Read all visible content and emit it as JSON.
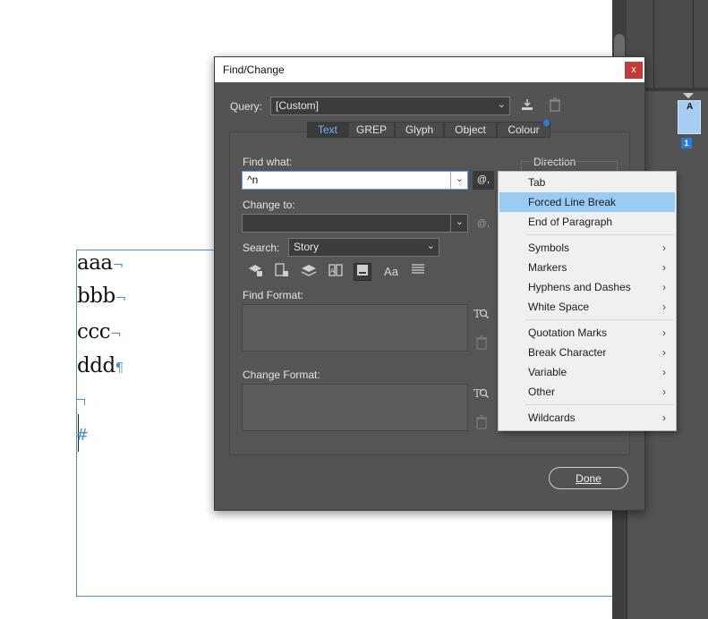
{
  "document": {
    "lines": [
      {
        "text": "aaa",
        "mark": "¬"
      },
      {
        "text": "bbb",
        "mark": "¬"
      },
      {
        "text": "ccc",
        "mark": "¬"
      },
      {
        "text": "ddd",
        "mark": "¶"
      }
    ],
    "end_mark": "#"
  },
  "pages_panel": {
    "master_label": "A",
    "page_number": "1"
  },
  "dialog": {
    "title": "Find/Change",
    "close_label": "x",
    "query_label": "Query:",
    "query_value": "[Custom]",
    "tabs": [
      {
        "label": "Text",
        "active": true
      },
      {
        "label": "GREP",
        "active": false
      },
      {
        "label": "Glyph",
        "active": false
      },
      {
        "label": "Object",
        "active": false
      },
      {
        "label": "Colour",
        "active": false
      }
    ],
    "find_what_label": "Find what:",
    "find_what_value": "^n",
    "direction_label": "Direction",
    "change_to_label": "Change to:",
    "change_to_value": "",
    "search_label": "Search:",
    "search_value": "Story",
    "find_format_label": "Find Format:",
    "change_format_label": "Change Format:",
    "done_label": "Done",
    "special_char_icon": "@,"
  },
  "menu": {
    "items": [
      {
        "label": "Tab",
        "submenu": false,
        "highlighted": false
      },
      {
        "label": "Forced Line Break",
        "submenu": false,
        "highlighted": true
      },
      {
        "label": "End of Paragraph",
        "submenu": false,
        "highlighted": false
      },
      {
        "label": "Symbols",
        "submenu": true,
        "highlighted": false
      },
      {
        "label": "Markers",
        "submenu": true,
        "highlighted": false
      },
      {
        "label": "Hyphens and Dashes",
        "submenu": true,
        "highlighted": false
      },
      {
        "label": "White Space",
        "submenu": true,
        "highlighted": false
      },
      {
        "label": "Quotation Marks",
        "submenu": true,
        "highlighted": false
      },
      {
        "label": "Break Character",
        "submenu": true,
        "highlighted": false
      },
      {
        "label": "Variable",
        "submenu": true,
        "highlighted": false
      },
      {
        "label": "Other",
        "submenu": true,
        "highlighted": false
      },
      {
        "label": "Wildcards",
        "submenu": true,
        "highlighted": false
      }
    ]
  },
  "colors": {
    "dialog_bg": "#535353",
    "accent": "#6fb2ff",
    "menu_highlight": "#9acbf2",
    "frame_edge": "#4f8fd6"
  }
}
